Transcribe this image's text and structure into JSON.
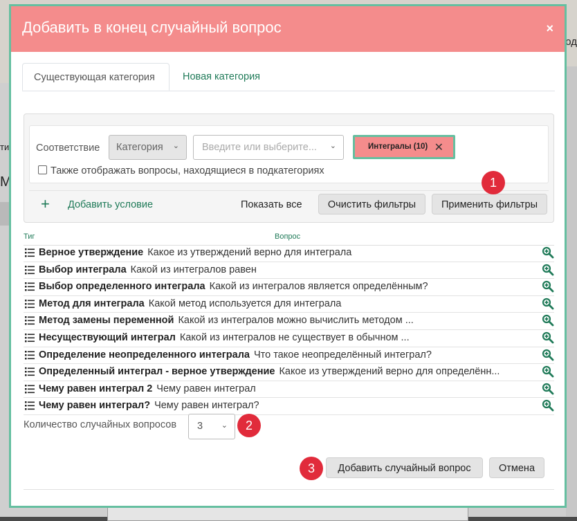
{
  "background": {
    "right_text": "од",
    "left_text_1": "ти",
    "left_text_2": "М",
    "left_text_3": "нк"
  },
  "modal": {
    "title": "Добавить в конец случайный вопрос",
    "close_label": "×",
    "tabs": [
      {
        "label": "Существующая категория",
        "active": true
      },
      {
        "label": "Новая категория",
        "active": false
      }
    ],
    "filter": {
      "match_label": "Соответствие",
      "category_select": "Категория",
      "search_placeholder": "Введите или выберите...",
      "tag_label": "Интегралы (10)",
      "tag_remove": "✕",
      "subcategory_label": "Также отображать вопросы, находящиеся в подкатегориях",
      "subcategory_checked": false,
      "add_condition": "Добавить условие",
      "show_all": "Показать все",
      "clear_filters": "Очистить фильтры",
      "apply_filters": "Применить фильтры"
    },
    "list_headers": {
      "type": "Тиг",
      "question": "Вопрос"
    },
    "questions": [
      {
        "name": "Верное утверждение",
        "text": "Какое из утверждений верно для интеграла"
      },
      {
        "name": "Выбор интеграла",
        "text": "Какой из интегралов равен"
      },
      {
        "name": "Выбор определенного интеграла",
        "text": "Какой из интегралов является определённым?"
      },
      {
        "name": "Метод для интеграла",
        "text": "Какой метод используется для интеграла"
      },
      {
        "name": "Метод замены переменной",
        "text": "Какой из интегралов можно вычислить методом ..."
      },
      {
        "name": "Несуществующий интеграл",
        "text": "Какой из интегралов не существует в обычном ..."
      },
      {
        "name": "Определение неопределенного интеграла",
        "text": "Что такое неопределённый интеграл?"
      },
      {
        "name": "Определенный интеграл - верное утверждение",
        "text": "Какое из утверждений верно для определённ..."
      },
      {
        "name": "Чему равен интеграл 2",
        "text": "Чему равен интеграл"
      },
      {
        "name": "Чему равен интеграл?",
        "text": "Чему равен интеграл?"
      }
    ],
    "count_label": "Количество случайных вопросов",
    "count_value": "3",
    "add_button": "Добавить случайный вопрос",
    "cancel_button": "Отмена",
    "badges": [
      "1",
      "2",
      "3"
    ],
    "colors": {
      "header": "#f48c8c",
      "accent_border": "#65bfa0",
      "link": "#1f7a58",
      "badge": "#e12b3b"
    }
  }
}
